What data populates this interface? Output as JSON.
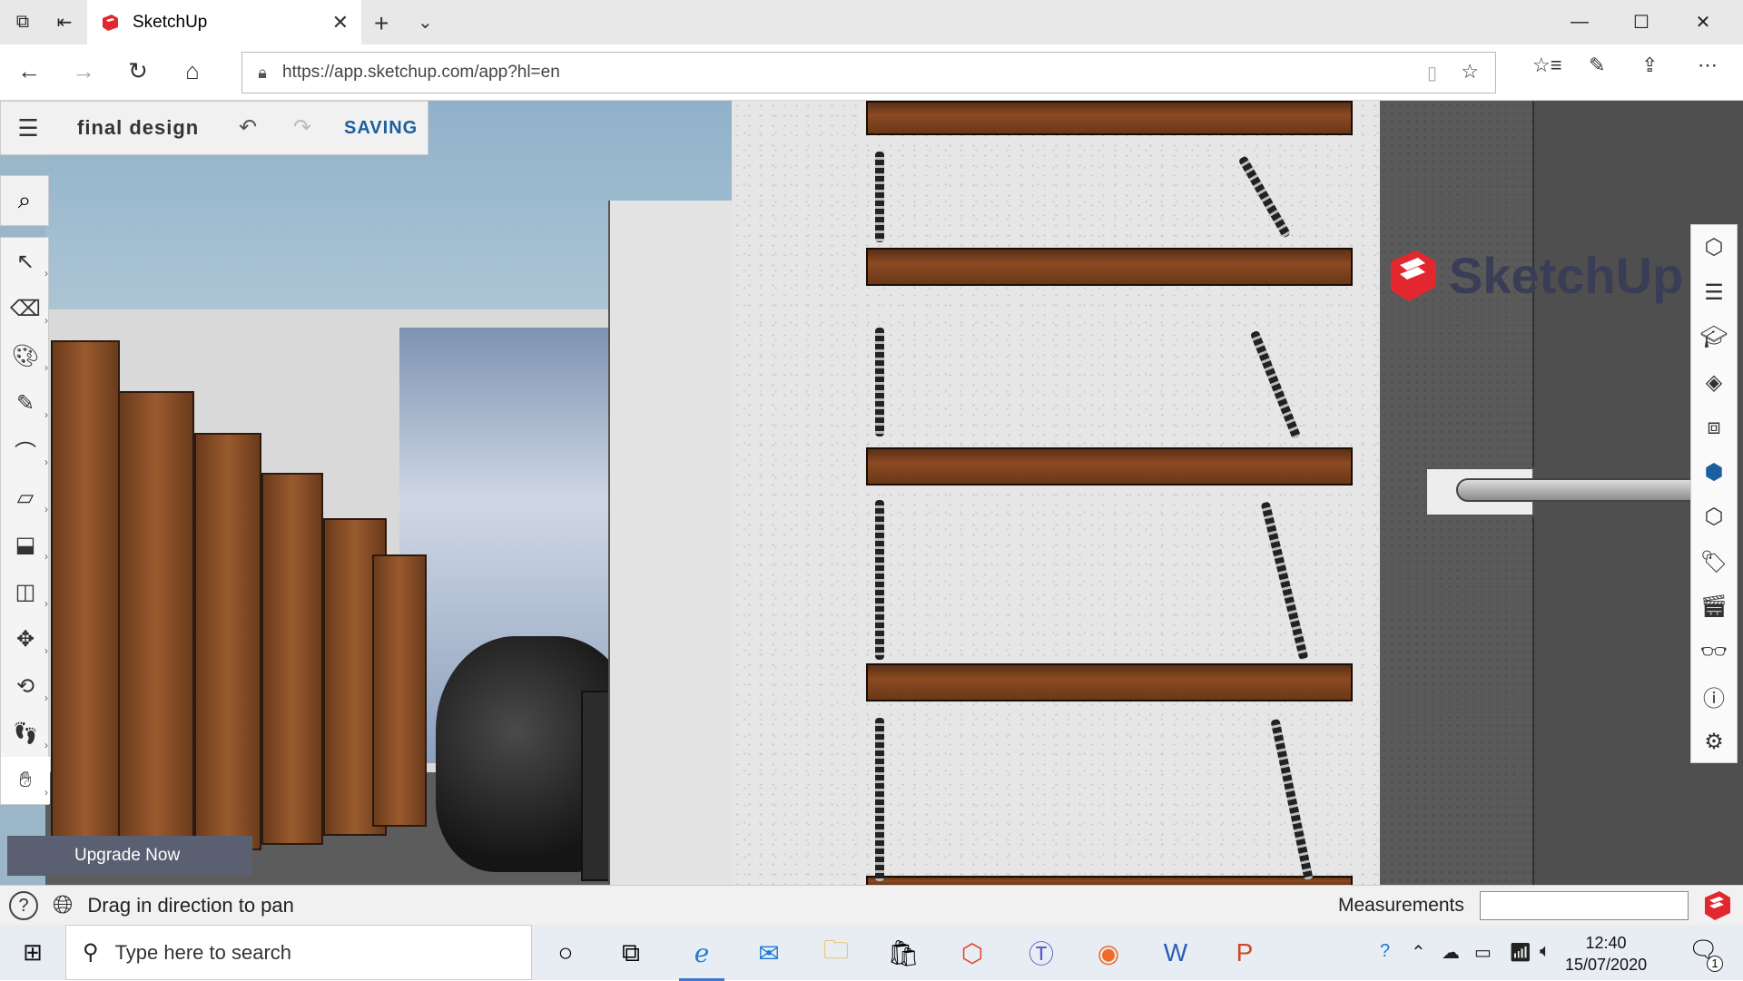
{
  "browser": {
    "tab_title": "SketchUp",
    "url": "https://app.sketchup.com/app?hl=en",
    "tab_close": "✕",
    "new_tab": "+",
    "tab_menu": "⌄"
  },
  "app": {
    "document_title": "final design",
    "status": "SAVING",
    "watermark": "SketchUp",
    "upgrade_label": "Upgrade Now"
  },
  "left_tools": [
    "select",
    "eraser",
    "paint",
    "pencil",
    "arc",
    "rectangle",
    "push-pull",
    "offset",
    "move",
    "orbit",
    "walk",
    "pan"
  ],
  "right_panel": [
    "entity-info",
    "outliner",
    "components",
    "materials",
    "styles",
    "views",
    "solid-tools",
    "tags",
    "scenes",
    "display",
    "model-info",
    "instructor"
  ],
  "statusbar": {
    "hint": "Drag in direction to pan",
    "measurements_label": "Measurements",
    "measurements_value": ""
  },
  "taskbar": {
    "search_placeholder": "Type here to search",
    "time": "12:40",
    "date": "15/07/2020",
    "notifications": "1"
  },
  "colors": {
    "accent": "#1c5f9e",
    "upgrade_bg": "#5b5f72",
    "logo_red": "#e2282e"
  }
}
